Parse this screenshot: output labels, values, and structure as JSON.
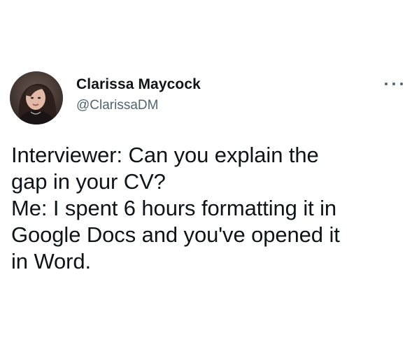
{
  "author": {
    "display_name": "Clarissa Maycock",
    "handle": "@ClarissaDM",
    "avatar_icon": "profile-photo"
  },
  "menu": {
    "icon": "more-options-icon"
  },
  "tweet": {
    "lines": [
      "Interviewer: Can you explain the",
      "gap in your CV?",
      "Me: I spent 6 hours formatting it in",
      "Google Docs and you've opened it",
      "in Word."
    ]
  },
  "colors": {
    "text": "#0f1419",
    "secondary_text": "#536471",
    "background": "#ffffff"
  }
}
